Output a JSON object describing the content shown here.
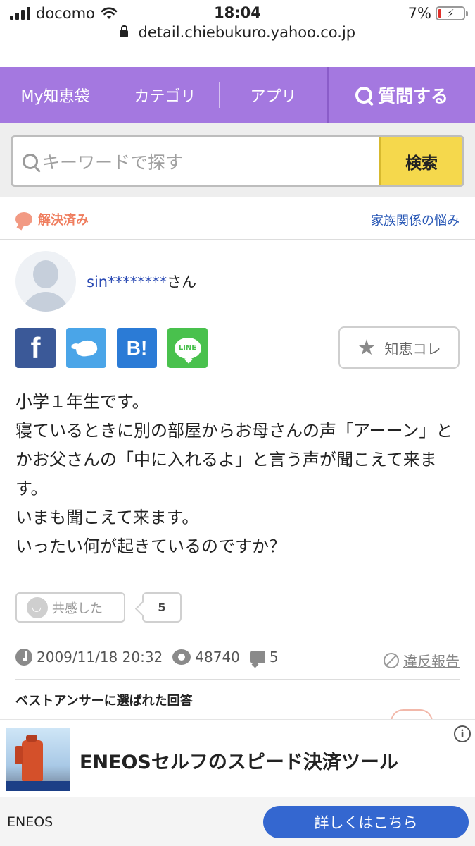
{
  "statusbar": {
    "carrier": "docomo",
    "time": "18:04",
    "battery": "7%"
  },
  "browser": {
    "url": "detail.chiebukuro.yahoo.co.jp"
  },
  "nav": {
    "items": [
      "My知恵袋",
      "カテゴリ",
      "アプリ"
    ],
    "ask_label": "質問する"
  },
  "search": {
    "placeholder": "キーワードで探す",
    "button_label": "検索"
  },
  "question": {
    "status": "解決済み",
    "category": "家族関係の悩み",
    "user": {
      "name": "sin********",
      "suffix": "さん"
    },
    "chiekore_label": "知恵コレ",
    "body": [
      "小学１年生です。",
      "寝ているときに別の部屋からお母さんの声「アーーン」とかお父さんの「中に入れるよ」と言う声が聞こえて来ます。",
      "いまも聞こえて来ます。",
      "いったい何が起きているのですか？"
    ],
    "empathy_label": "共感した",
    "empathy_count": "5",
    "date": "2009/11/18 20:32",
    "views": "48740",
    "answers": "5",
    "report_label": "違反報告",
    "best_answer_heading": "ベストアンサーに選ばれた回答"
  },
  "share": {
    "facebook": "f",
    "hatena": "B!",
    "line": "LINE"
  },
  "ad": {
    "title": "ENEOSセルフのスピード決済ツール",
    "sponsor": "ENEOS",
    "cta": "詳しくはこちら",
    "info_icon": "i"
  },
  "colors": {
    "nav": "#a478e0",
    "search_button": "#f5d84c",
    "link": "#2a59b6",
    "resolved": "#ef7d5e",
    "cta": "#3467d0"
  }
}
